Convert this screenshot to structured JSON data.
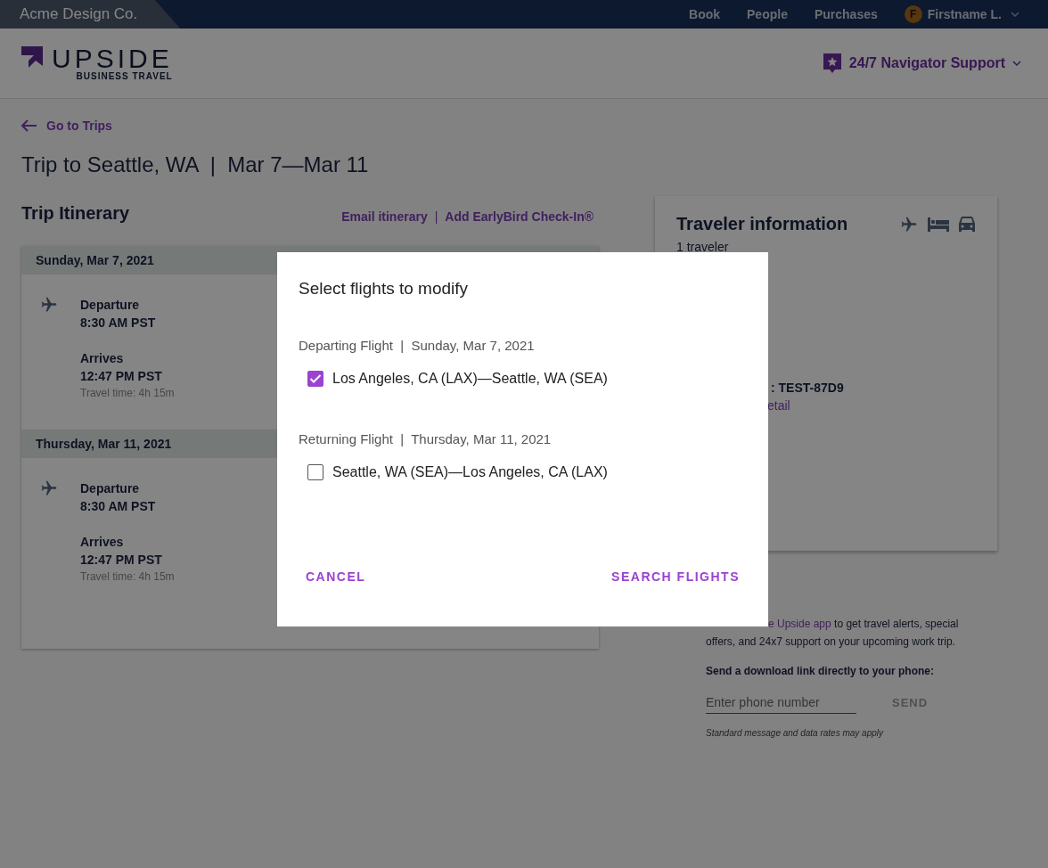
{
  "top_bar": {
    "company": "Acme Design Co.",
    "nav": [
      "Book",
      "People",
      "Purchases"
    ],
    "user": {
      "initial": "F",
      "name": "Firstname L."
    }
  },
  "header": {
    "logo": {
      "name": "UPSIDE",
      "tagline": "BUSINESS TRAVEL"
    },
    "support": "24/7 Navigator Support"
  },
  "back_link": "Go to Trips",
  "trip_title": "Trip to Seattle, WA  |  Mar 7—Mar 11",
  "itinerary": {
    "title": "Trip Itinerary",
    "links": [
      "Email itinerary",
      "Add EarlyBird Check-In®"
    ],
    "link_separator": "|",
    "days": [
      {
        "date": "Sunday, Mar 7, 2021",
        "departure_label": "Departure",
        "departure_time": "8:30 AM PST",
        "arrival_label": "Arrives",
        "arrival_time": "12:47 PM PST",
        "travel_time": "Travel time: 4h 15m"
      },
      {
        "date": "Thursday, Mar 11, 2021",
        "departure_label": "Departure",
        "departure_time": "8:30 AM PST",
        "arrival_label": "Arrives",
        "arrival_time": "12:47 PM PST",
        "travel_time": "Travel time: 4h 15m"
      }
    ]
  },
  "traveler_card": {
    "title": "Traveler information",
    "count": "1 traveler",
    "confirmation": ": TEST-87D9",
    "link": "etail"
  },
  "app_promo": {
    "link": "e Upside app",
    "text": "to get travel alerts, special offers, and 24x7 support on your upcoming work trip.",
    "prompt": "Send a download link directly to your phone:",
    "phone_placeholder": "Enter phone number",
    "send": "SEND",
    "disclaimer": "Standard message and data rates may apply"
  },
  "modal": {
    "title": "Select flights to modify",
    "sections": [
      {
        "label": "Departing Flight  |  Sunday, Mar 7, 2021",
        "route": "Los Angeles, CA (LAX)—Seattle, WA (SEA)",
        "checked": true
      },
      {
        "label": "Returning Flight  |  Thursday, Mar 11, 2021",
        "route": "Seattle, WA (SEA)—Los Angeles, CA (LAX)",
        "checked": false
      }
    ],
    "cancel": "CANCEL",
    "confirm": "SEARCH FLIGHTS"
  }
}
